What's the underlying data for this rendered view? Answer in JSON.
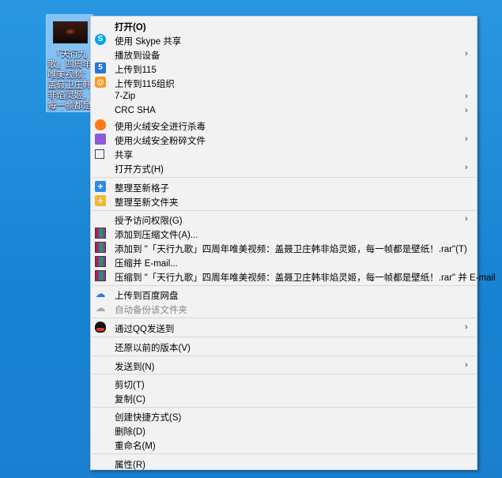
{
  "desktop_file": {
    "name": "「天行九歌」四周年唯美视频：盖聂卫庄韩非焰灵姬，每一帧都是壁纸！.mkv"
  },
  "context_menu": {
    "items": [
      {
        "label": "打开(O)",
        "icon": "",
        "bold": true
      },
      {
        "label": "使用 Skype 共享",
        "icon": "skype-icon"
      },
      {
        "label": "播放到设备",
        "icon": "",
        "submenu": true
      },
      {
        "label": "上传到115",
        "icon": "115-icon"
      },
      {
        "label": "上传到115组织",
        "icon": "115-org-icon"
      },
      {
        "label": "7-Zip",
        "icon": "",
        "submenu": true
      },
      {
        "label": "CRC SHA",
        "icon": "",
        "submenu": true
      },
      {
        "label": "使用火绒安全进行杀毒",
        "icon": "huorong-icon"
      },
      {
        "label": "使用火绒安全粉碎文件",
        "icon": "shredder-icon",
        "submenu": true
      },
      {
        "label": "共享",
        "icon": "share-icon"
      },
      {
        "label": "打开方式(H)",
        "icon": "",
        "submenu": true
      },
      {
        "label": "整理至新格子",
        "icon": "grid-plus-icon"
      },
      {
        "label": "整理至新文件夹",
        "icon": "folder-plus-icon"
      },
      {
        "label": "授予访问权限(G)",
        "icon": "",
        "submenu": true
      },
      {
        "label": "添加到压缩文件(A)...",
        "icon": "winrar-icon"
      },
      {
        "label": "添加到 \"「天行九歌」四周年唯美视频：盖聂卫庄韩非焰灵姬，每一帧都是壁纸！.rar\"(T)",
        "icon": "winrar-icon"
      },
      {
        "label": "压缩并 E-mail...",
        "icon": "winrar-icon"
      },
      {
        "label": "压缩到 \"「天行九歌」四周年唯美视频：盖聂卫庄韩非焰灵姬，每一帧都是壁纸！.rar\" 并 E-mail",
        "icon": "winrar-icon"
      },
      {
        "label": "上传到百度网盘",
        "icon": "baidu-cloud-icon"
      },
      {
        "label": "自动备份该文件夹",
        "icon": "baidu-cloud-icon",
        "disabled": true
      },
      {
        "label": "通过QQ发送到",
        "icon": "qq-icon",
        "submenu": true
      },
      {
        "label": "还原以前的版本(V)",
        "icon": ""
      },
      {
        "label": "发送到(N)",
        "icon": "",
        "submenu": true
      },
      {
        "label": "剪切(T)",
        "icon": ""
      },
      {
        "label": "复制(C)",
        "icon": ""
      },
      {
        "label": "创建快捷方式(S)",
        "icon": ""
      },
      {
        "label": "删除(D)",
        "icon": ""
      },
      {
        "label": "重命名(M)",
        "icon": ""
      },
      {
        "label": "属性(R)",
        "icon": ""
      }
    ],
    "submenu_arrow": "›"
  }
}
